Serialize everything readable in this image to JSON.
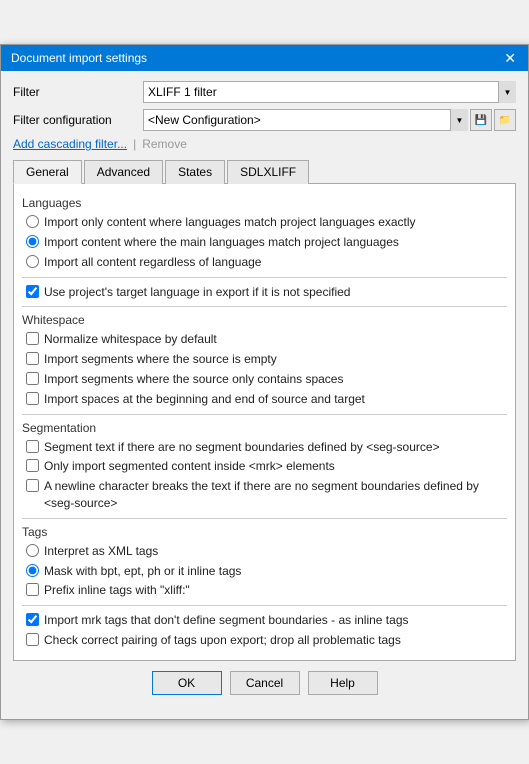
{
  "titleBar": {
    "title": "Document import settings",
    "closeLabel": "✕"
  },
  "filterRow": {
    "label": "Filter",
    "selectedOption": "XLIFF 1 filter",
    "options": [
      "XLIFF 1 filter"
    ]
  },
  "filterConfigRow": {
    "label": "Filter configuration",
    "selectedOption": "<New Configuration>",
    "options": [
      "<New Configuration>"
    ],
    "iconSave": "💾",
    "iconFolder": "📁"
  },
  "links": {
    "addCascading": "Add cascading filter...",
    "separator": "|",
    "remove": "Remove"
  },
  "tabs": [
    {
      "id": "general",
      "label": "General",
      "active": true
    },
    {
      "id": "advanced",
      "label": "Advanced",
      "active": false
    },
    {
      "id": "states",
      "label": "States",
      "active": false
    },
    {
      "id": "sdlxliff",
      "label": "SDLXLIFF",
      "active": false
    }
  ],
  "sections": {
    "languages": {
      "heading": "Languages",
      "radios": [
        {
          "id": "lang1",
          "label": "Import only content where languages match project languages exactly",
          "checked": false
        },
        {
          "id": "lang2",
          "label": "Import content where the main languages match project languages",
          "checked": true
        },
        {
          "id": "lang3",
          "label": "Import all content regardless of language",
          "checked": false
        }
      ],
      "checkbox": {
        "id": "langCheck",
        "label": "Use project's target language in export if it is not specified",
        "checked": true
      }
    },
    "whitespace": {
      "heading": "Whitespace",
      "checkboxes": [
        {
          "id": "ws1",
          "label": "Normalize whitespace by default",
          "checked": false
        },
        {
          "id": "ws2",
          "label": "Import segments where the source is empty",
          "checked": false
        },
        {
          "id": "ws3",
          "label": "Import segments where the source only contains spaces",
          "checked": false
        },
        {
          "id": "ws4",
          "label": "Import spaces at the beginning and end of source and target",
          "checked": false
        }
      ]
    },
    "segmentation": {
      "heading": "Segmentation",
      "checkboxes": [
        {
          "id": "seg1",
          "label": "Segment text if there are no segment boundaries defined by <seg-source>",
          "checked": false
        },
        {
          "id": "seg2",
          "label": "Only import segmented content inside <mrk> elements",
          "checked": false
        },
        {
          "id": "seg3",
          "label": "A newline character breaks the text if there are no segment boundaries defined by <seg-source>",
          "checked": false
        }
      ]
    },
    "tags": {
      "heading": "Tags",
      "radios": [
        {
          "id": "tag1",
          "label": "Interpret as XML tags",
          "checked": false
        },
        {
          "id": "tag2",
          "label": "Mask with bpt, ept, ph or it inline tags",
          "checked": true
        },
        {
          "id": "tag3",
          "label": "Prefix inline tags with \"xliff:\"",
          "checked": false,
          "isCheckbox": true
        }
      ]
    },
    "bottomCheckboxes": [
      {
        "id": "bot1",
        "label": "Import mrk tags that don't define segment boundaries - as inline tags",
        "checked": true
      },
      {
        "id": "bot2",
        "label": "Check correct pairing of tags upon export; drop all problematic tags",
        "checked": false
      }
    ]
  },
  "footer": {
    "okLabel": "OK",
    "cancelLabel": "Cancel",
    "helpLabel": "Help"
  }
}
